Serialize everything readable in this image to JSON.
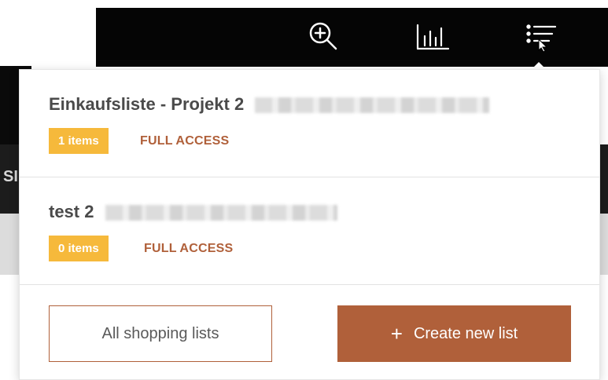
{
  "toolbar": {
    "icons": [
      "zoom-in-icon",
      "chart-icon",
      "list-menu-icon"
    ],
    "colors": {
      "background": "#050505",
      "icon": "#ffffff"
    }
  },
  "background": {
    "side_fragment": "SI"
  },
  "dropdown": {
    "lists": [
      {
        "title": "Einkaufsliste - Projekt 2",
        "items_badge": "1 items",
        "access": "FULL ACCESS"
      },
      {
        "title": "test 2",
        "items_badge": "0 items",
        "access": "FULL ACCESS"
      }
    ],
    "all_lists_button": "All shopping lists",
    "create_button": "Create new list",
    "create_icon": "+"
  },
  "colors": {
    "accent": "#b0603a",
    "badge": "#f6b93b",
    "title_text": "#4a4a4a"
  }
}
